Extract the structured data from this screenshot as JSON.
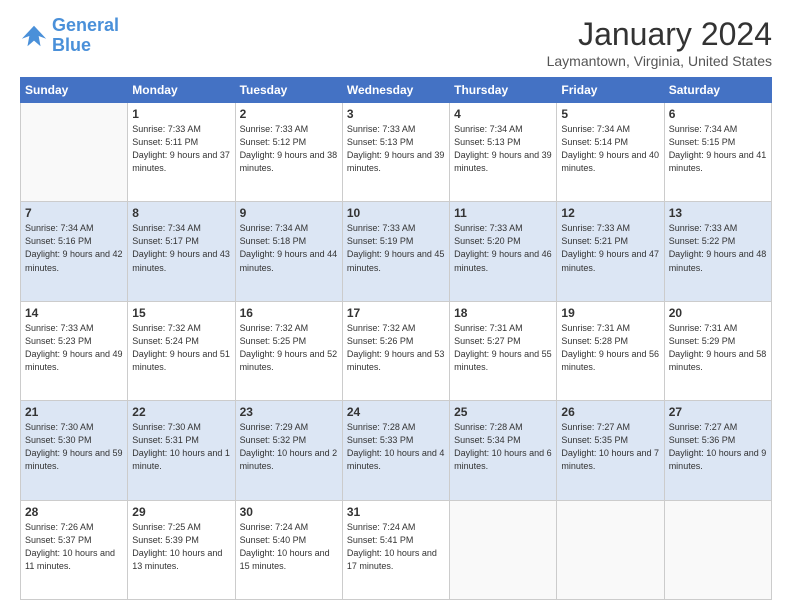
{
  "header": {
    "logo_general": "General",
    "logo_blue": "Blue",
    "month_year": "January 2024",
    "location": "Laymantown, Virginia, United States"
  },
  "days_of_week": [
    "Sunday",
    "Monday",
    "Tuesday",
    "Wednesday",
    "Thursday",
    "Friday",
    "Saturday"
  ],
  "weeks": [
    [
      {
        "day": "",
        "sunrise": "",
        "sunset": "",
        "daylight": ""
      },
      {
        "day": "1",
        "sunrise": "Sunrise: 7:33 AM",
        "sunset": "Sunset: 5:11 PM",
        "daylight": "Daylight: 9 hours and 37 minutes."
      },
      {
        "day": "2",
        "sunrise": "Sunrise: 7:33 AM",
        "sunset": "Sunset: 5:12 PM",
        "daylight": "Daylight: 9 hours and 38 minutes."
      },
      {
        "day": "3",
        "sunrise": "Sunrise: 7:33 AM",
        "sunset": "Sunset: 5:13 PM",
        "daylight": "Daylight: 9 hours and 39 minutes."
      },
      {
        "day": "4",
        "sunrise": "Sunrise: 7:34 AM",
        "sunset": "Sunset: 5:13 PM",
        "daylight": "Daylight: 9 hours and 39 minutes."
      },
      {
        "day": "5",
        "sunrise": "Sunrise: 7:34 AM",
        "sunset": "Sunset: 5:14 PM",
        "daylight": "Daylight: 9 hours and 40 minutes."
      },
      {
        "day": "6",
        "sunrise": "Sunrise: 7:34 AM",
        "sunset": "Sunset: 5:15 PM",
        "daylight": "Daylight: 9 hours and 41 minutes."
      }
    ],
    [
      {
        "day": "7",
        "sunrise": "Sunrise: 7:34 AM",
        "sunset": "Sunset: 5:16 PM",
        "daylight": "Daylight: 9 hours and 42 minutes."
      },
      {
        "day": "8",
        "sunrise": "Sunrise: 7:34 AM",
        "sunset": "Sunset: 5:17 PM",
        "daylight": "Daylight: 9 hours and 43 minutes."
      },
      {
        "day": "9",
        "sunrise": "Sunrise: 7:34 AM",
        "sunset": "Sunset: 5:18 PM",
        "daylight": "Daylight: 9 hours and 44 minutes."
      },
      {
        "day": "10",
        "sunrise": "Sunrise: 7:33 AM",
        "sunset": "Sunset: 5:19 PM",
        "daylight": "Daylight: 9 hours and 45 minutes."
      },
      {
        "day": "11",
        "sunrise": "Sunrise: 7:33 AM",
        "sunset": "Sunset: 5:20 PM",
        "daylight": "Daylight: 9 hours and 46 minutes."
      },
      {
        "day": "12",
        "sunrise": "Sunrise: 7:33 AM",
        "sunset": "Sunset: 5:21 PM",
        "daylight": "Daylight: 9 hours and 47 minutes."
      },
      {
        "day": "13",
        "sunrise": "Sunrise: 7:33 AM",
        "sunset": "Sunset: 5:22 PM",
        "daylight": "Daylight: 9 hours and 48 minutes."
      }
    ],
    [
      {
        "day": "14",
        "sunrise": "Sunrise: 7:33 AM",
        "sunset": "Sunset: 5:23 PM",
        "daylight": "Daylight: 9 hours and 49 minutes."
      },
      {
        "day": "15",
        "sunrise": "Sunrise: 7:32 AM",
        "sunset": "Sunset: 5:24 PM",
        "daylight": "Daylight: 9 hours and 51 minutes."
      },
      {
        "day": "16",
        "sunrise": "Sunrise: 7:32 AM",
        "sunset": "Sunset: 5:25 PM",
        "daylight": "Daylight: 9 hours and 52 minutes."
      },
      {
        "day": "17",
        "sunrise": "Sunrise: 7:32 AM",
        "sunset": "Sunset: 5:26 PM",
        "daylight": "Daylight: 9 hours and 53 minutes."
      },
      {
        "day": "18",
        "sunrise": "Sunrise: 7:31 AM",
        "sunset": "Sunset: 5:27 PM",
        "daylight": "Daylight: 9 hours and 55 minutes."
      },
      {
        "day": "19",
        "sunrise": "Sunrise: 7:31 AM",
        "sunset": "Sunset: 5:28 PM",
        "daylight": "Daylight: 9 hours and 56 minutes."
      },
      {
        "day": "20",
        "sunrise": "Sunrise: 7:31 AM",
        "sunset": "Sunset: 5:29 PM",
        "daylight": "Daylight: 9 hours and 58 minutes."
      }
    ],
    [
      {
        "day": "21",
        "sunrise": "Sunrise: 7:30 AM",
        "sunset": "Sunset: 5:30 PM",
        "daylight": "Daylight: 9 hours and 59 minutes."
      },
      {
        "day": "22",
        "sunrise": "Sunrise: 7:30 AM",
        "sunset": "Sunset: 5:31 PM",
        "daylight": "Daylight: 10 hours and 1 minute."
      },
      {
        "day": "23",
        "sunrise": "Sunrise: 7:29 AM",
        "sunset": "Sunset: 5:32 PM",
        "daylight": "Daylight: 10 hours and 2 minutes."
      },
      {
        "day": "24",
        "sunrise": "Sunrise: 7:28 AM",
        "sunset": "Sunset: 5:33 PM",
        "daylight": "Daylight: 10 hours and 4 minutes."
      },
      {
        "day": "25",
        "sunrise": "Sunrise: 7:28 AM",
        "sunset": "Sunset: 5:34 PM",
        "daylight": "Daylight: 10 hours and 6 minutes."
      },
      {
        "day": "26",
        "sunrise": "Sunrise: 7:27 AM",
        "sunset": "Sunset: 5:35 PM",
        "daylight": "Daylight: 10 hours and 7 minutes."
      },
      {
        "day": "27",
        "sunrise": "Sunrise: 7:27 AM",
        "sunset": "Sunset: 5:36 PM",
        "daylight": "Daylight: 10 hours and 9 minutes."
      }
    ],
    [
      {
        "day": "28",
        "sunrise": "Sunrise: 7:26 AM",
        "sunset": "Sunset: 5:37 PM",
        "daylight": "Daylight: 10 hours and 11 minutes."
      },
      {
        "day": "29",
        "sunrise": "Sunrise: 7:25 AM",
        "sunset": "Sunset: 5:39 PM",
        "daylight": "Daylight: 10 hours and 13 minutes."
      },
      {
        "day": "30",
        "sunrise": "Sunrise: 7:24 AM",
        "sunset": "Sunset: 5:40 PM",
        "daylight": "Daylight: 10 hours and 15 minutes."
      },
      {
        "day": "31",
        "sunrise": "Sunrise: 7:24 AM",
        "sunset": "Sunset: 5:41 PM",
        "daylight": "Daylight: 10 hours and 17 minutes."
      },
      {
        "day": "",
        "sunrise": "",
        "sunset": "",
        "daylight": ""
      },
      {
        "day": "",
        "sunrise": "",
        "sunset": "",
        "daylight": ""
      },
      {
        "day": "",
        "sunrise": "",
        "sunset": "",
        "daylight": ""
      }
    ]
  ]
}
